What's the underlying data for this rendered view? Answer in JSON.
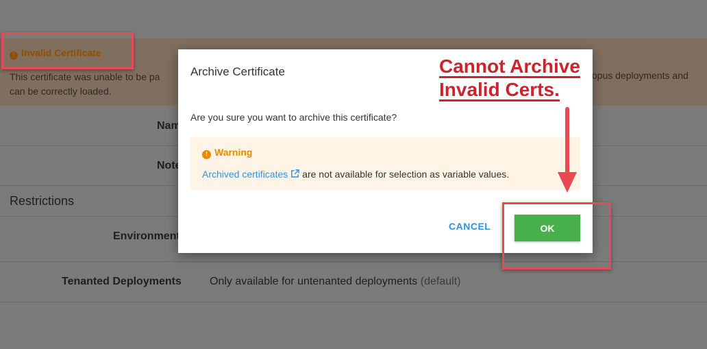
{
  "banner": {
    "title": "Invalid Certificate",
    "text_line1": "This certificate was unable to be pa",
    "text_line2": "can be correctly loaded.",
    "text_right": "topus deployments and"
  },
  "form": {
    "name_label": "Nam",
    "notes_label": "Note",
    "restrictions_heading": "Restrictions",
    "environments_label": "Environment",
    "tenanted_label": "Tenanted Deployments",
    "tenanted_value": "Only available for untenanted deployments",
    "tenanted_default": "(default)"
  },
  "dialog": {
    "title": "Archive Certificate",
    "question": "Are you sure you want to archive this certificate?",
    "warning_title": "Warning",
    "warning_link": "Archived certificates",
    "warning_text": " are not available for selection as variable values.",
    "cancel_label": "CANCEL",
    "ok_label": "OK"
  },
  "annotation": {
    "line1": "Cannot Archive",
    "line2": "Invalid Certs.",
    "color": "#d0222d"
  },
  "icons": {
    "banner": "exclamation-circle-icon",
    "warning": "exclamation-circle-icon",
    "external_link": "external-link-icon"
  },
  "colors": {
    "accent": "#2f93e0",
    "ok_button": "#47b04b",
    "warning": "#e98700",
    "annotation_box": "#e84a55"
  }
}
